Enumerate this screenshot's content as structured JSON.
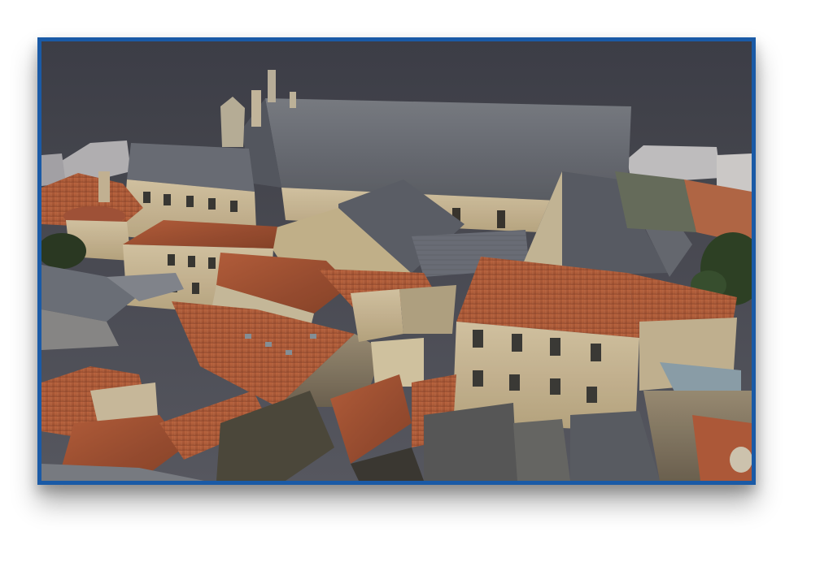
{
  "image": {
    "subject": "aerial-photogrammetry-rooftops",
    "frame_color": "#1a5aa6",
    "sky_color": "#4b4c55",
    "roof_tile_color": "#b5603c",
    "slate_color": "#6b6f78",
    "stone_wall_color": "#cdbb98"
  }
}
